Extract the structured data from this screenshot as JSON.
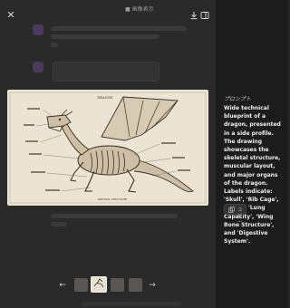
{
  "viewer": {
    "title": "■ 画像表示",
    "close_icon": "close-icon",
    "download_icon": "download-icon",
    "panel_icon": "panel-toggle-icon"
  },
  "image": {
    "caption_title": "DRAGON",
    "caption_bottom": "SKELETAL STRUCTURE"
  },
  "carousel": {
    "prev_label": "←",
    "next_label": "→",
    "thumbnail_count": 4,
    "selected_index": 1
  },
  "sidebar": {
    "prompt_label": "プロンプト",
    "description": "Wide technical blueprint of a dragon, presented in a side profile. The drawing showcases the skeletal structure, muscular layout, and major organs of the dragon. Labels indicate: 'Skull', 'Rib Cage', 'Heart', 'Lung Capacity', 'Wing Bone Structure', and 'Digestive System'.",
    "copy_label": "コピー"
  },
  "colors": {
    "sidebar_bg": "#1c1c1c",
    "page_bg": "#262626",
    "parchment": "#ebe3d3",
    "ink": "#3b2e24"
  }
}
